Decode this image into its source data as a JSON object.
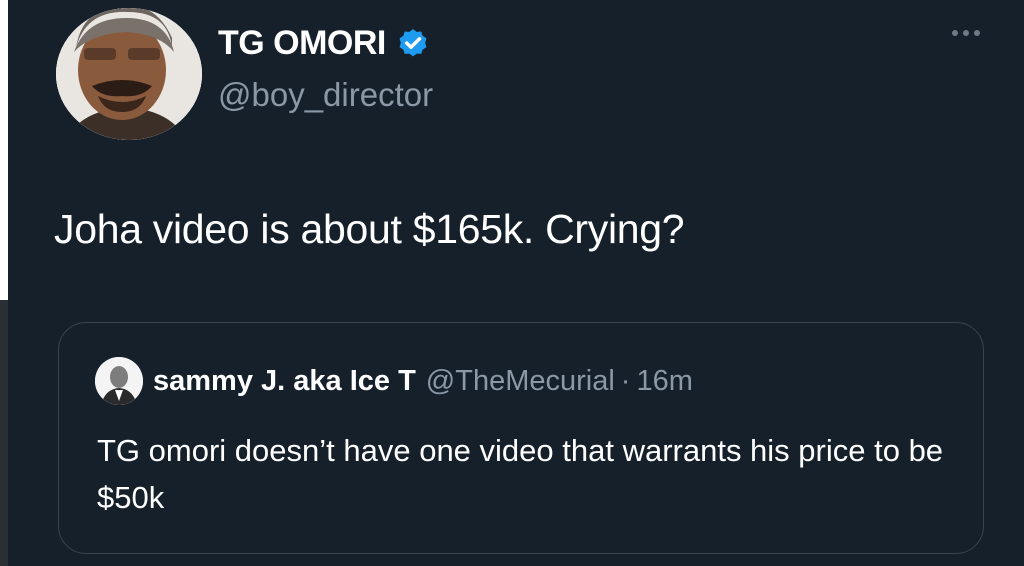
{
  "tweet": {
    "author": {
      "display_name": "TG OMORI",
      "handle": "@boy_director",
      "verified": true
    },
    "text": "Joha video is about $165k. Crying?",
    "more_icon": "more-horizontal-icon",
    "quoted": {
      "author": {
        "display_name": "sammy J. aka Ice T",
        "handle": "@TheMecurial"
      },
      "separator": "·",
      "time": "16m",
      "text": "TG omori doesn’t have one video that warrants his price to be $50k"
    }
  },
  "colors": {
    "background": "#15202b",
    "text_primary": "#ffffff",
    "text_secondary": "#8b98a5",
    "border": "#38444d",
    "verified": "#1d9bf0"
  }
}
